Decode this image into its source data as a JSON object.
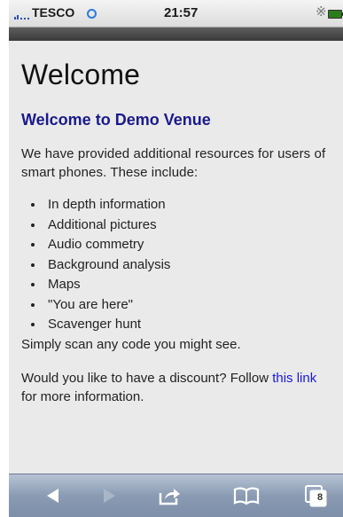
{
  "status_bar": {
    "carrier": "TESCO",
    "time": "21:57",
    "bluetooth_icon": "bluetooth-icon",
    "battery_icon": "battery-icon",
    "wifi_icon": "wifi-icon"
  },
  "page": {
    "title": "Welcome",
    "subtitle": "Welcome to Demo Venue",
    "intro": "We have provided additional resources for users of smart phones.  These include:",
    "features": [
      "In depth information",
      "Additional pictures",
      "Audio commetry",
      "Background analysis",
      "Maps",
      "\"You are here\"",
      "Scavenger hunt"
    ],
    "scan_text": "Simply scan any code you might see.",
    "discount_before": "Would you like to have a discount? Follow ",
    "discount_link": "this link",
    "discount_after": " for more information."
  },
  "toolbar": {
    "tab_count": "8",
    "icons": [
      "back-icon",
      "forward-icon",
      "share-icon",
      "bookmarks-icon",
      "tabs-icon"
    ]
  },
  "colors": {
    "subtitle": "#1a1a8c",
    "link": "#1a1ae0",
    "content_background": "#eaeaea",
    "toolbar": "#8a9bb3"
  }
}
